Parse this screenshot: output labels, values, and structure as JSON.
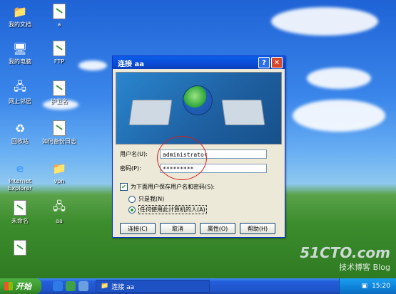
{
  "desktop": {
    "icons": [
      {
        "label": "我的文档"
      },
      {
        "label": "a"
      },
      {
        "label": "我的电脑"
      },
      {
        "label": "FTP"
      },
      {
        "label": "网上邻居"
      },
      {
        "label": "护卫名"
      },
      {
        "label": "回收站"
      },
      {
        "label": "如何备份日志"
      },
      {
        "label": "Internet Explorer"
      },
      {
        "label": "vpn"
      },
      {
        "label": "未命名"
      },
      {
        "label": "aa"
      },
      {
        "label": ""
      }
    ]
  },
  "dialog": {
    "title": "连接 aa",
    "username_label": "用户名(U):",
    "username_value": "administrator",
    "password_label": "密码(P):",
    "password_value": "*********",
    "save_checkbox_label": "为下面用户保存用户名和密码(S):",
    "save_checked": true,
    "radio_me": "只是我(N)",
    "radio_anyone": "任何使用此计算机的人(A)",
    "selected_radio": "anyone",
    "buttons": {
      "connect": "连接(C)",
      "cancel": "取消",
      "properties": "属性(O)",
      "help": "帮助(H)"
    }
  },
  "taskbar": {
    "start_label": "开始",
    "task_label": "连接 aa",
    "clock": "15:20"
  },
  "watermark": {
    "line1": "51CTO.com",
    "line2": "技术博客",
    "line3": "Blog"
  },
  "colors": {
    "title_blue": "#0a5fe8",
    "start_green": "#3c9a2f",
    "annotation_red": "#d91e1e"
  }
}
